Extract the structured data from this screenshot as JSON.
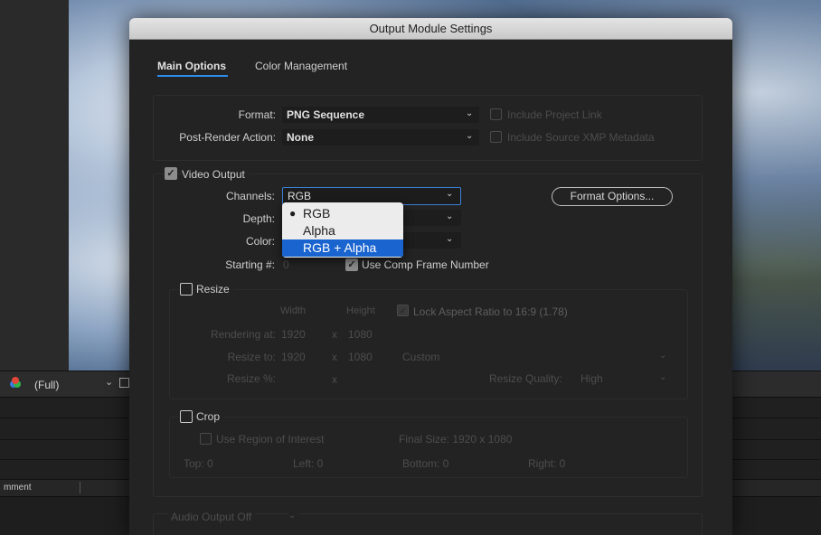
{
  "background": {
    "resolution": "(Full)",
    "timeline_column": "mment"
  },
  "dialog": {
    "title": "Output Module Settings",
    "tabs": [
      {
        "label": "Main Options",
        "active": true
      },
      {
        "label": "Color Management",
        "active": false
      }
    ],
    "format": {
      "format_label": "Format:",
      "format_value": "PNG Sequence",
      "post_render_label": "Post-Render Action:",
      "post_render_value": "None",
      "include_project_link": "Include Project Link",
      "include_xmp": "Include Source XMP Metadata"
    },
    "video": {
      "enabled": true,
      "label": "Video Output",
      "channels_label": "Channels:",
      "channels_value": "RGB",
      "depth_label": "Depth:",
      "color_label": "Color:",
      "starting_label": "Starting #:",
      "starting_value": "0",
      "use_comp_frame": "Use Comp Frame Number",
      "format_options_button": "Format Options..."
    },
    "resize": {
      "label": "Resize",
      "width_header": "Width",
      "height_header": "Height",
      "lock_aspect": "Lock Aspect Ratio to 16:9 (1.78)",
      "rendering_at_label": "Rendering at:",
      "rendering_w": "1920",
      "rendering_h": "1080",
      "resize_to_label": "Resize to:",
      "resize_to_w": "1920",
      "resize_to_h": "1080",
      "resize_to_preset": "Custom",
      "resize_pct_label": "Resize %:",
      "x_sep": "x",
      "quality_label": "Resize Quality:",
      "quality_value": "High"
    },
    "crop": {
      "label": "Crop",
      "use_roi": "Use Region of Interest",
      "final_size": "Final Size: 1920 x 1080",
      "top": "Top:  0",
      "left": "Left:  0",
      "bottom": "Bottom:  0",
      "right": "Right:  0"
    },
    "audio": {
      "label": "Audio Output Off"
    }
  },
  "channels_dropdown": {
    "options": [
      "RGB",
      "Alpha",
      "RGB + Alpha"
    ],
    "checked": "RGB",
    "highlighted": "RGB + Alpha"
  },
  "colors": {
    "accent": "#2d8ceb",
    "highlight": "#1a64d0",
    "dialog_bg": "#232323"
  }
}
